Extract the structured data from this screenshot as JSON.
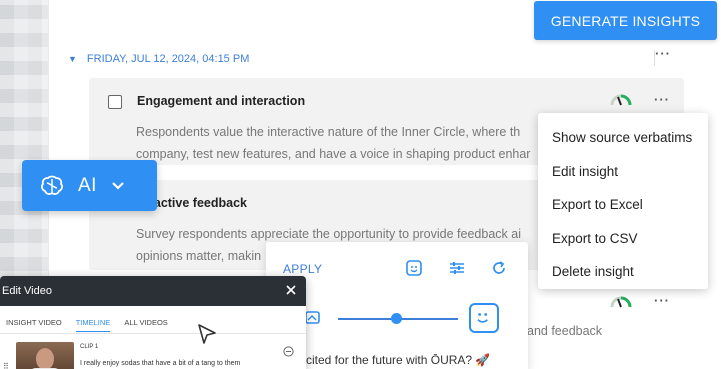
{
  "header": {
    "generate_label": "GENERATE INSIGHTS"
  },
  "session": {
    "date_label": "FRIDAY, JUL 12, 2024, 04:15 PM"
  },
  "insights": [
    {
      "title": "Engagement and interaction",
      "body_line1": "Respondents value the interactive nature of the Inner Circle, where th",
      "body_line2": "company, test new features, and have a voice in shaping product enhar"
    },
    {
      "title": "ractive feedback",
      "body_line1": "Survey respondents appreciate the opportunity to provide feedback ai",
      "body_line2": "opinions matter, makin"
    }
  ],
  "context_menu": {
    "items": [
      "Show source verbatims",
      "Edit insight",
      "Export to Excel",
      "Export to CSV",
      "Delete insight"
    ]
  },
  "ai_button": {
    "label": "AI"
  },
  "apply_panel": {
    "apply_label": "APPLY"
  },
  "fragments": {
    "and_feedback": "and feedback",
    "excited_text": "xcited for the future with ŌURA? 🚀"
  },
  "edit_video": {
    "title": "Edit Video",
    "tabs": [
      "INSIGHT VIDEO",
      "TIMELINE",
      "ALL VIDEOS"
    ],
    "clip_label": "CLIP 1",
    "clip_quote": "I really enjoy sodas that have a bit of a tang to them"
  },
  "colors": {
    "accent": "#2f8ff2",
    "date_blue": "#3d7fd8",
    "panel_dark": "#2b2f36"
  }
}
